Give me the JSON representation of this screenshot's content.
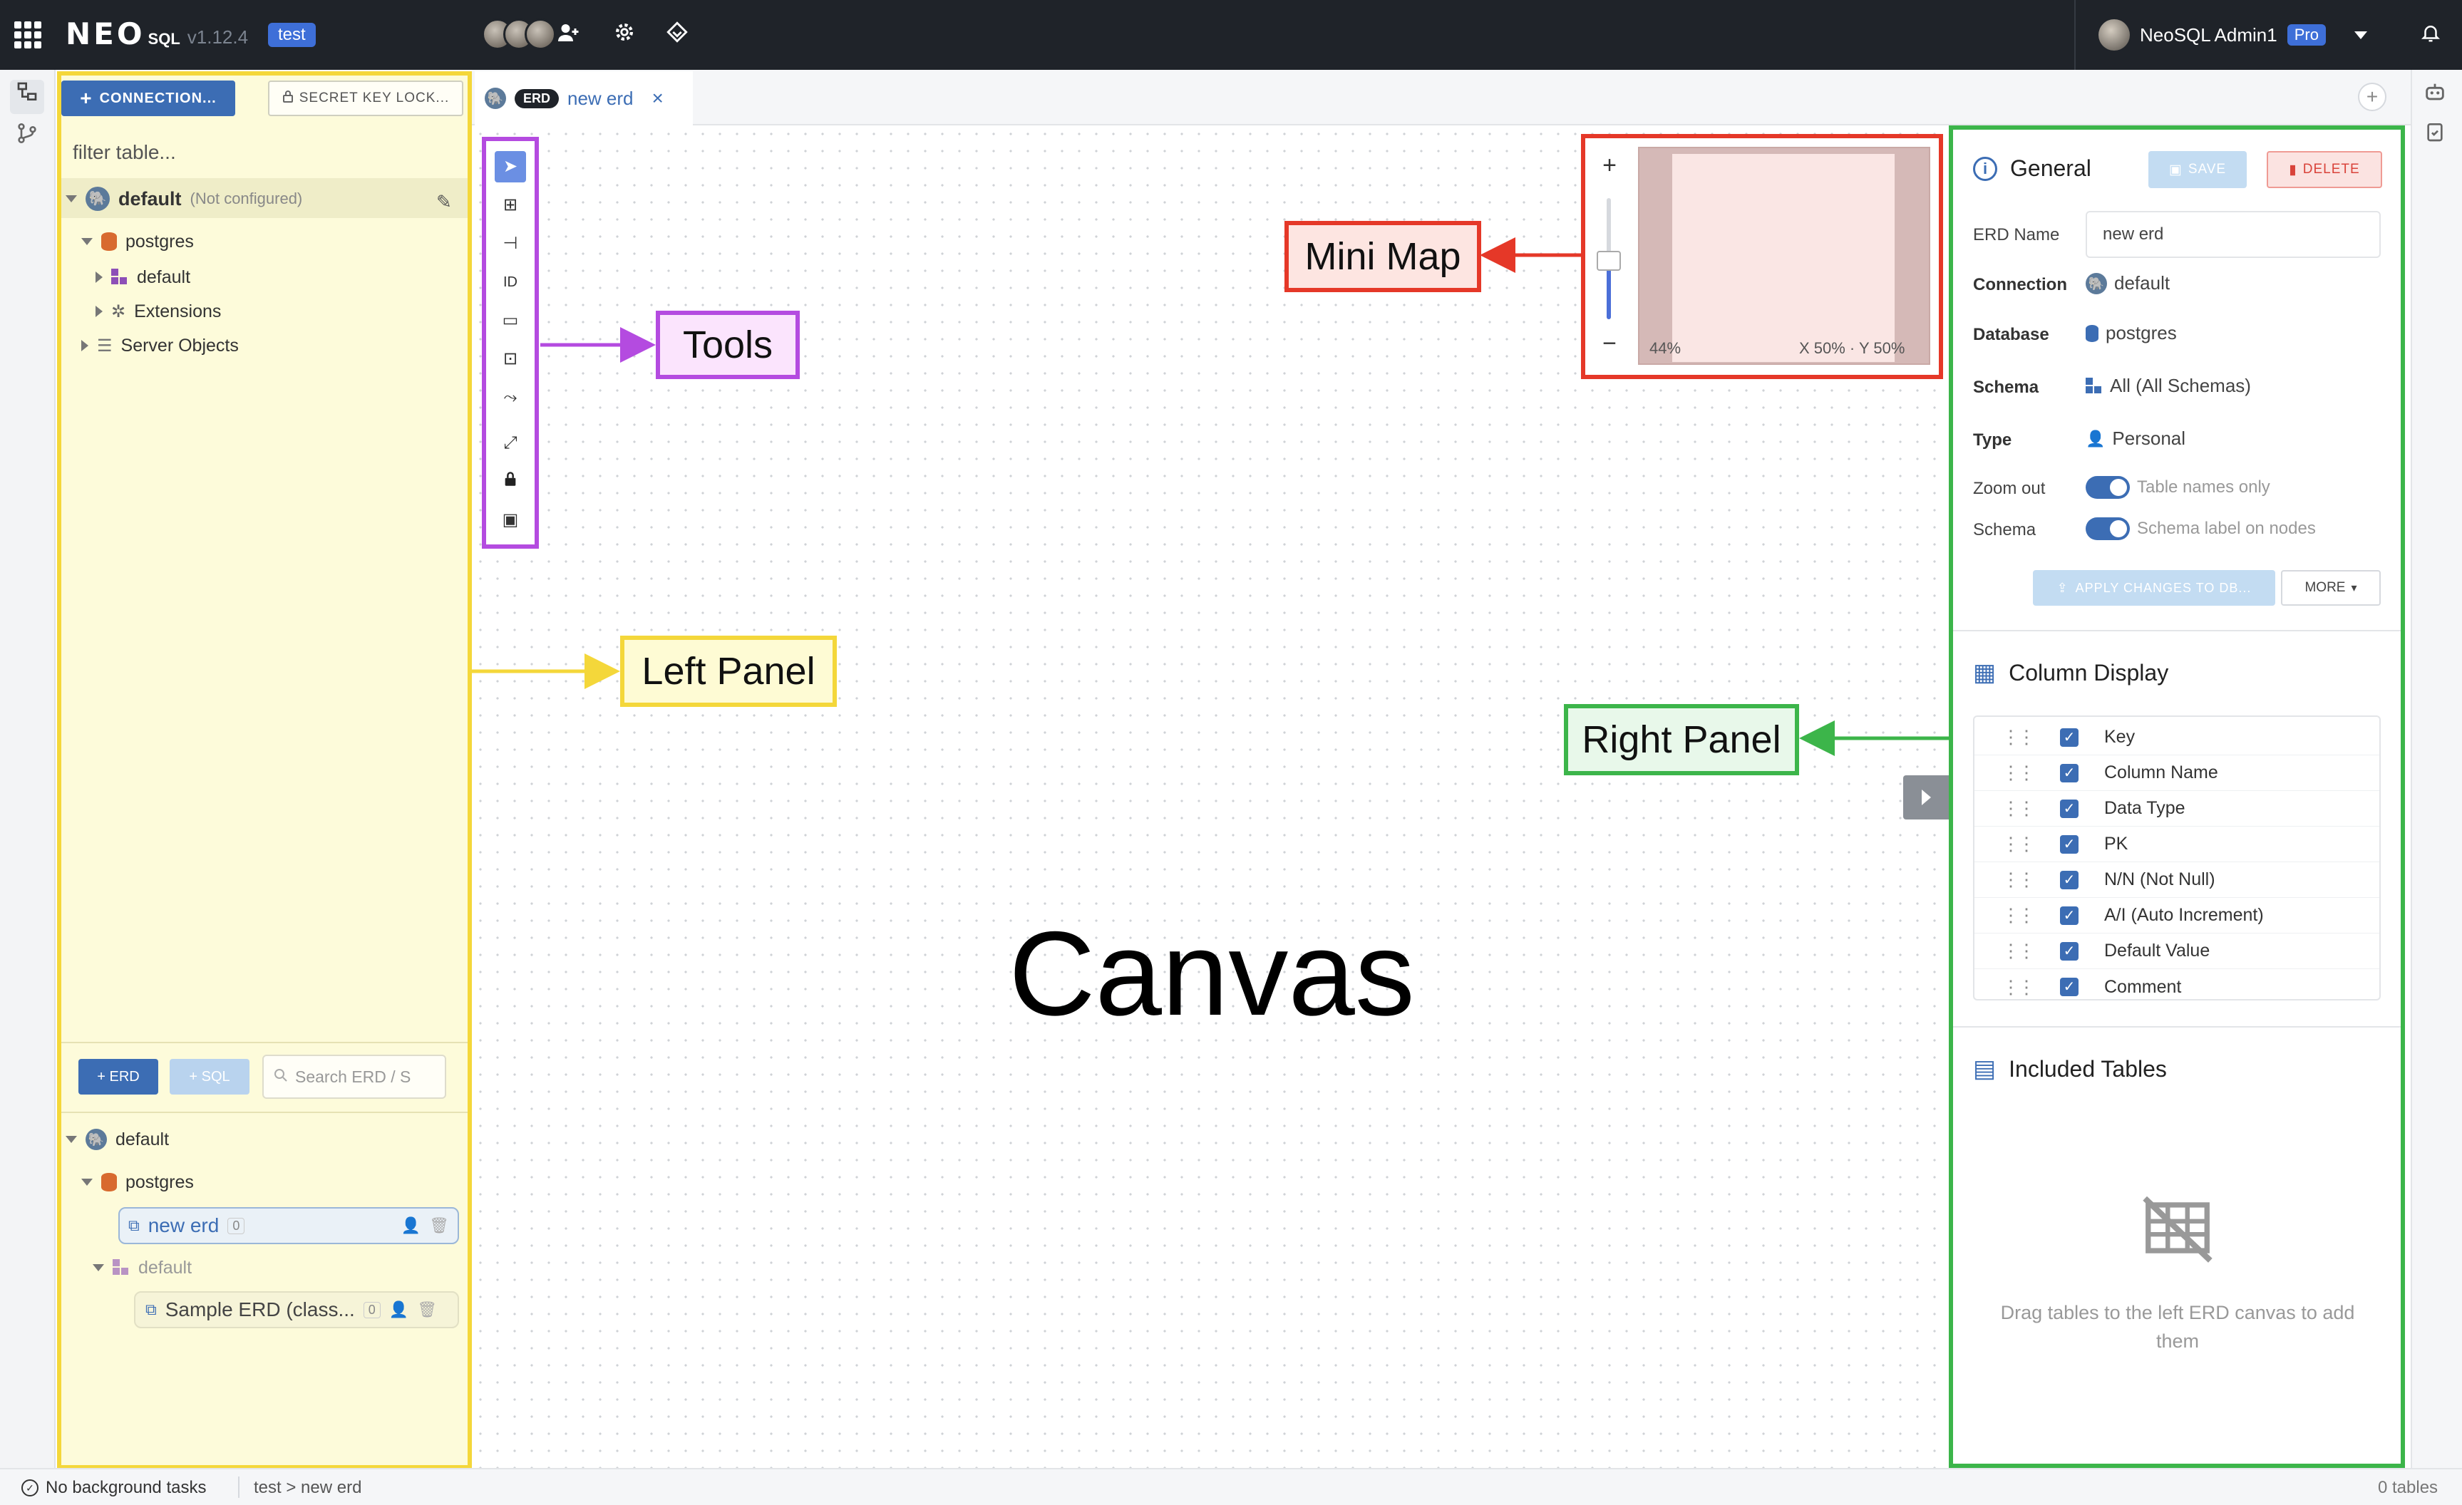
{
  "topbar": {
    "brand": "NEO",
    "brand_sub": "SQL",
    "version": "v1.12.4",
    "env_badge": "test",
    "user_name": "NeoSQL Admin1",
    "user_badge": "Pro"
  },
  "left_panel": {
    "connection_button": "CONNECTION...",
    "secret_button": "SECRET KEY LOCK...",
    "filter_placeholder": "filter table...",
    "tree": {
      "connection": "default",
      "connection_status": "(Not configured)",
      "database": "postgres",
      "schema": "default",
      "extensions": "Extensions",
      "server_objects": "Server Objects"
    },
    "erd_button": "ERD",
    "sql_button": "SQL",
    "erd_search_placeholder": "Search ERD / S",
    "erd_tree": {
      "connection": "default",
      "database": "postgres",
      "erd_name": "new erd",
      "erd_count": "0",
      "schema": "default",
      "sample_erd": "Sample ERD (class...",
      "sample_count": "0"
    }
  },
  "tab": {
    "badge": "ERD",
    "title": "new erd"
  },
  "canvas": {
    "label": "Canvas"
  },
  "minimap": {
    "zoom": "44%",
    "position": "X 50% · Y 50%"
  },
  "callouts": {
    "tools": "Tools",
    "minimap": "Mini Map",
    "left_panel": "Left Panel",
    "right_panel": "Right Panel"
  },
  "right_panel": {
    "general_title": "General",
    "save_button": "SAVE",
    "delete_button": "DELETE",
    "erd_name_label": "ERD Name",
    "erd_name_value": "new erd",
    "connection_label": "Connection",
    "connection_value": "default",
    "database_label": "Database",
    "database_value": "postgres",
    "schema_label": "Schema",
    "schema_value": "All (All Schemas)",
    "type_label": "Type",
    "type_value": "Personal",
    "zoom_out_label": "Zoom out",
    "zoom_out_toggle": "Table names only",
    "schema_toggle_label": "Schema",
    "schema_toggle": "Schema label on nodes",
    "apply_button": "APPLY CHANGES TO DB...",
    "more_button": "MORE",
    "column_display_title": "Column Display",
    "columns": [
      "Key",
      "Column Name",
      "Data Type",
      "PK",
      "N/N (Not Null)",
      "A/I (Auto Increment)",
      "Default Value",
      "Comment"
    ],
    "included_tables_title": "Included Tables",
    "empty_text": "Drag tables to the left ERD canvas to add them"
  },
  "status": {
    "tasks": "No background tasks",
    "breadcrumb": "test > new erd",
    "tables": "0 tables"
  },
  "colors": {
    "accent": "#3c6db4",
    "left_panel_outline": "#f4d73a",
    "tools_outline": "#b44be0",
    "minimap_outline": "#e53828",
    "right_panel_outline": "#3cb54a"
  }
}
